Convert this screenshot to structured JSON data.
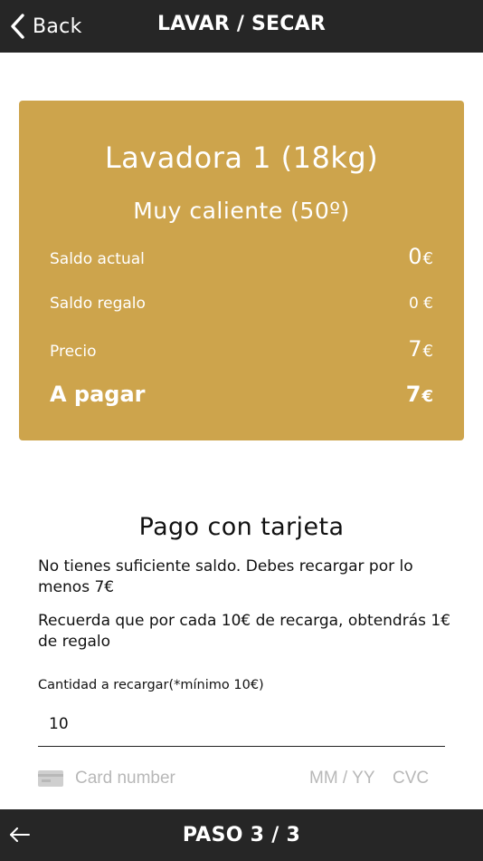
{
  "header": {
    "back_label": "Back",
    "title": "LAVAR / SECAR"
  },
  "summary": {
    "machine": "Lavadora 1 (18kg)",
    "program": "Muy caliente (50º)",
    "rows": [
      {
        "label": "Saldo actual",
        "value": "0",
        "currency": "€"
      },
      {
        "label": "Saldo regalo",
        "value": "0 €"
      },
      {
        "label": "Precio",
        "value": "7",
        "currency": "€"
      },
      {
        "label": "A pagar",
        "value": "7",
        "currency": "€"
      }
    ]
  },
  "payment": {
    "title": "Pago con tarjeta",
    "notice": "No tienes suficiente saldo. Debes recargar por lo menos 7€",
    "reminder": "Recuerda que por cada 10€ de recarga, obtendrás 1€ de regalo",
    "amount_label": "Cantidad a recargar(*mínimo 10€)",
    "amount_value": "10",
    "card_number_placeholder": "Card number",
    "expiry_placeholder": "MM / YY",
    "cvc_placeholder": "CVC"
  },
  "footer": {
    "step_label": "PASO 3 / 3"
  },
  "icons": {
    "back": "chevron-left-icon",
    "card": "credit-card-icon",
    "footer_back": "arrow-left-icon"
  },
  "colors": {
    "bar": "#262626",
    "card": "#cda44c",
    "placeholder": "#b8b8b8"
  }
}
